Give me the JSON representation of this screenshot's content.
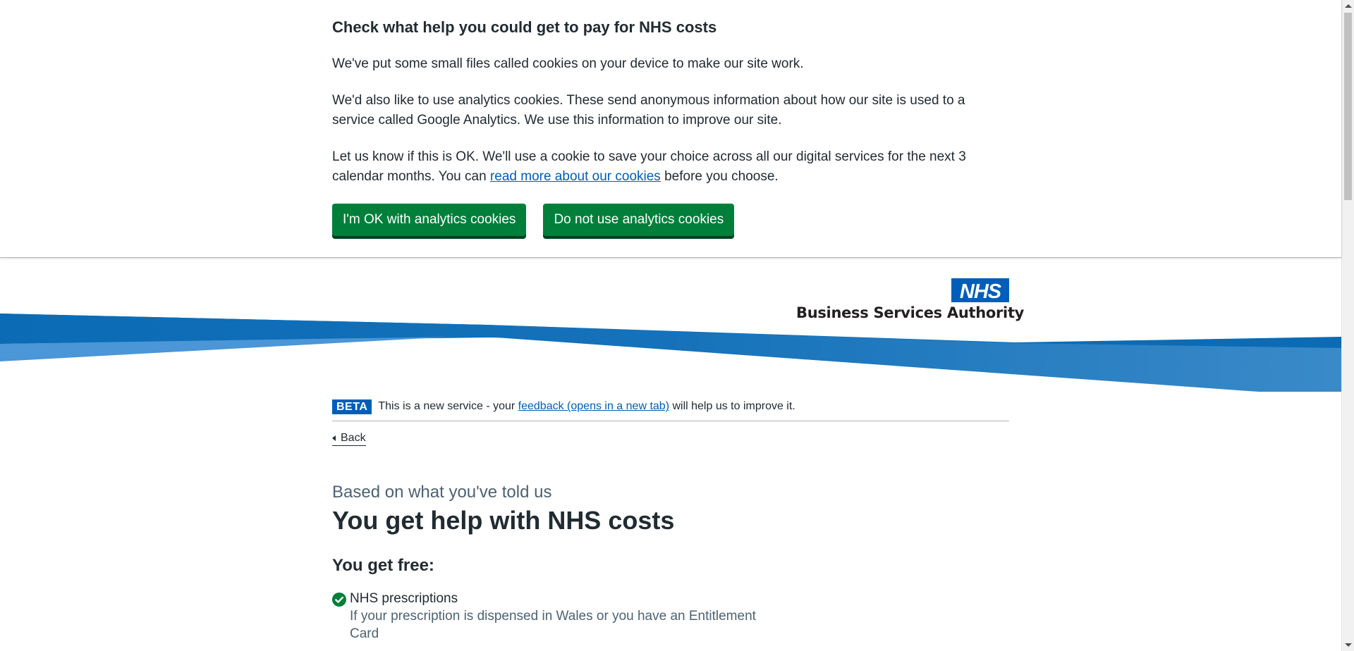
{
  "cookie_banner": {
    "title": "Check what help you could get to pay for NHS costs",
    "paragraph_1": "We've put some small files called cookies on your device to make our site work.",
    "paragraph_2": "We'd also like to use analytics cookies. These send anonymous information about how our site is used to a service called Google Analytics. We use this information to improve our site.",
    "paragraph_3_before": "Let us know if this is OK. We'll use a cookie to save your choice across all our digital services for the next 3 calendar months. You can ",
    "paragraph_3_link": "read more about our cookies",
    "paragraph_3_after": " before you choose.",
    "accept_label": "I'm OK with analytics cookies",
    "reject_label": "Do not use analytics cookies"
  },
  "header": {
    "logo_text": "NHS",
    "org_name": "Business Services Authority"
  },
  "phase_banner": {
    "tag": "BETA",
    "text_before": "This is a new service - your ",
    "link": "feedback (opens in a new tab)",
    "text_after": " will help us to improve it."
  },
  "back_link": "Back",
  "result": {
    "caption": "Based on what you've told us",
    "heading": "You get help with NHS costs",
    "subheading": "You get free:",
    "benefits": [
      {
        "title": "NHS prescriptions",
        "description": "If your prescription is dispensed in Wales or you have an Entitlement Card"
      }
    ]
  },
  "colors": {
    "nhs_blue": "#005eb8",
    "button_green": "#007f3b",
    "text_dark": "#212b32",
    "text_secondary": "#4c6272"
  }
}
